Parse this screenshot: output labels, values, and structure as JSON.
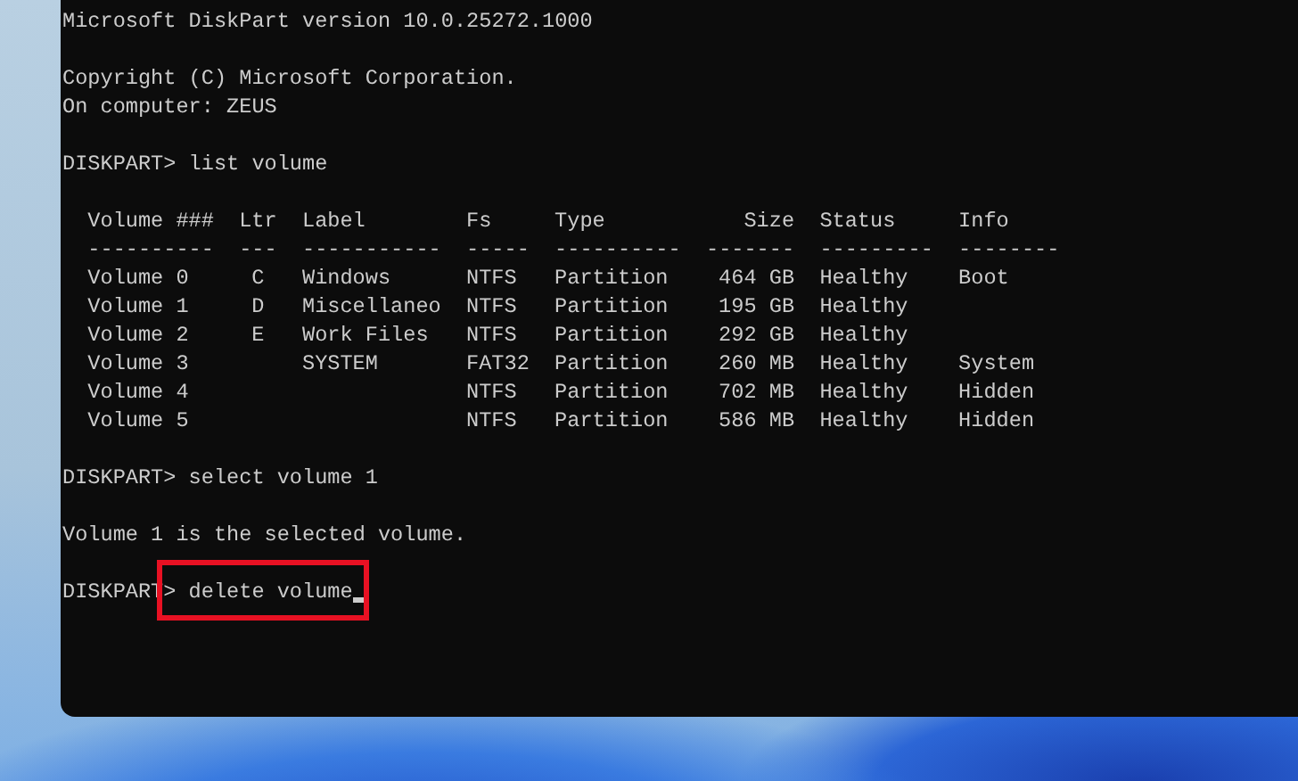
{
  "console": {
    "output": [
      {
        "kind": "text",
        "text": "Microsoft DiskPart version 10.0.25272.1000"
      },
      {
        "kind": "blank"
      },
      {
        "kind": "text",
        "text": "Copyright (C) Microsoft Corporation."
      },
      {
        "kind": "text",
        "text": "On computer: ZEUS"
      },
      {
        "kind": "blank"
      },
      {
        "kind": "prompt",
        "prompt": "DISKPART>",
        "command": "list volume"
      },
      {
        "kind": "blank"
      },
      {
        "kind": "table",
        "columns": [
          "Volume ###",
          "Ltr",
          "Label",
          "Fs",
          "Type",
          "Size",
          "Status",
          "Info"
        ],
        "separators": [
          "----------",
          "---",
          "-----------",
          "-----",
          "----------",
          "-------",
          "---------",
          "--------"
        ],
        "rows": [
          [
            "Volume 0",
            "C",
            "Windows",
            "NTFS",
            "Partition",
            "464 GB",
            "Healthy",
            "Boot"
          ],
          [
            "Volume 1",
            "D",
            "Miscellaneo",
            "NTFS",
            "Partition",
            "195 GB",
            "Healthy",
            ""
          ],
          [
            "Volume 2",
            "E",
            "Work Files",
            "NTFS",
            "Partition",
            "292 GB",
            "Healthy",
            ""
          ],
          [
            "Volume 3",
            "",
            "SYSTEM",
            "FAT32",
            "Partition",
            "260 MB",
            "Healthy",
            "System"
          ],
          [
            "Volume 4",
            "",
            "",
            "NTFS",
            "Partition",
            "702 MB",
            "Healthy",
            "Hidden"
          ],
          [
            "Volume 5",
            "",
            "",
            "NTFS",
            "Partition",
            "586 MB",
            "Healthy",
            "Hidden"
          ]
        ]
      },
      {
        "kind": "blank"
      },
      {
        "kind": "prompt",
        "prompt": "DISKPART>",
        "command": "select volume 1"
      },
      {
        "kind": "blank"
      },
      {
        "kind": "text",
        "text": "Volume 1 is the selected volume."
      },
      {
        "kind": "blank"
      },
      {
        "kind": "prompt",
        "prompt": "DISKPART>",
        "command": "delete volume",
        "highlighted": true,
        "cursor": true
      }
    ]
  }
}
